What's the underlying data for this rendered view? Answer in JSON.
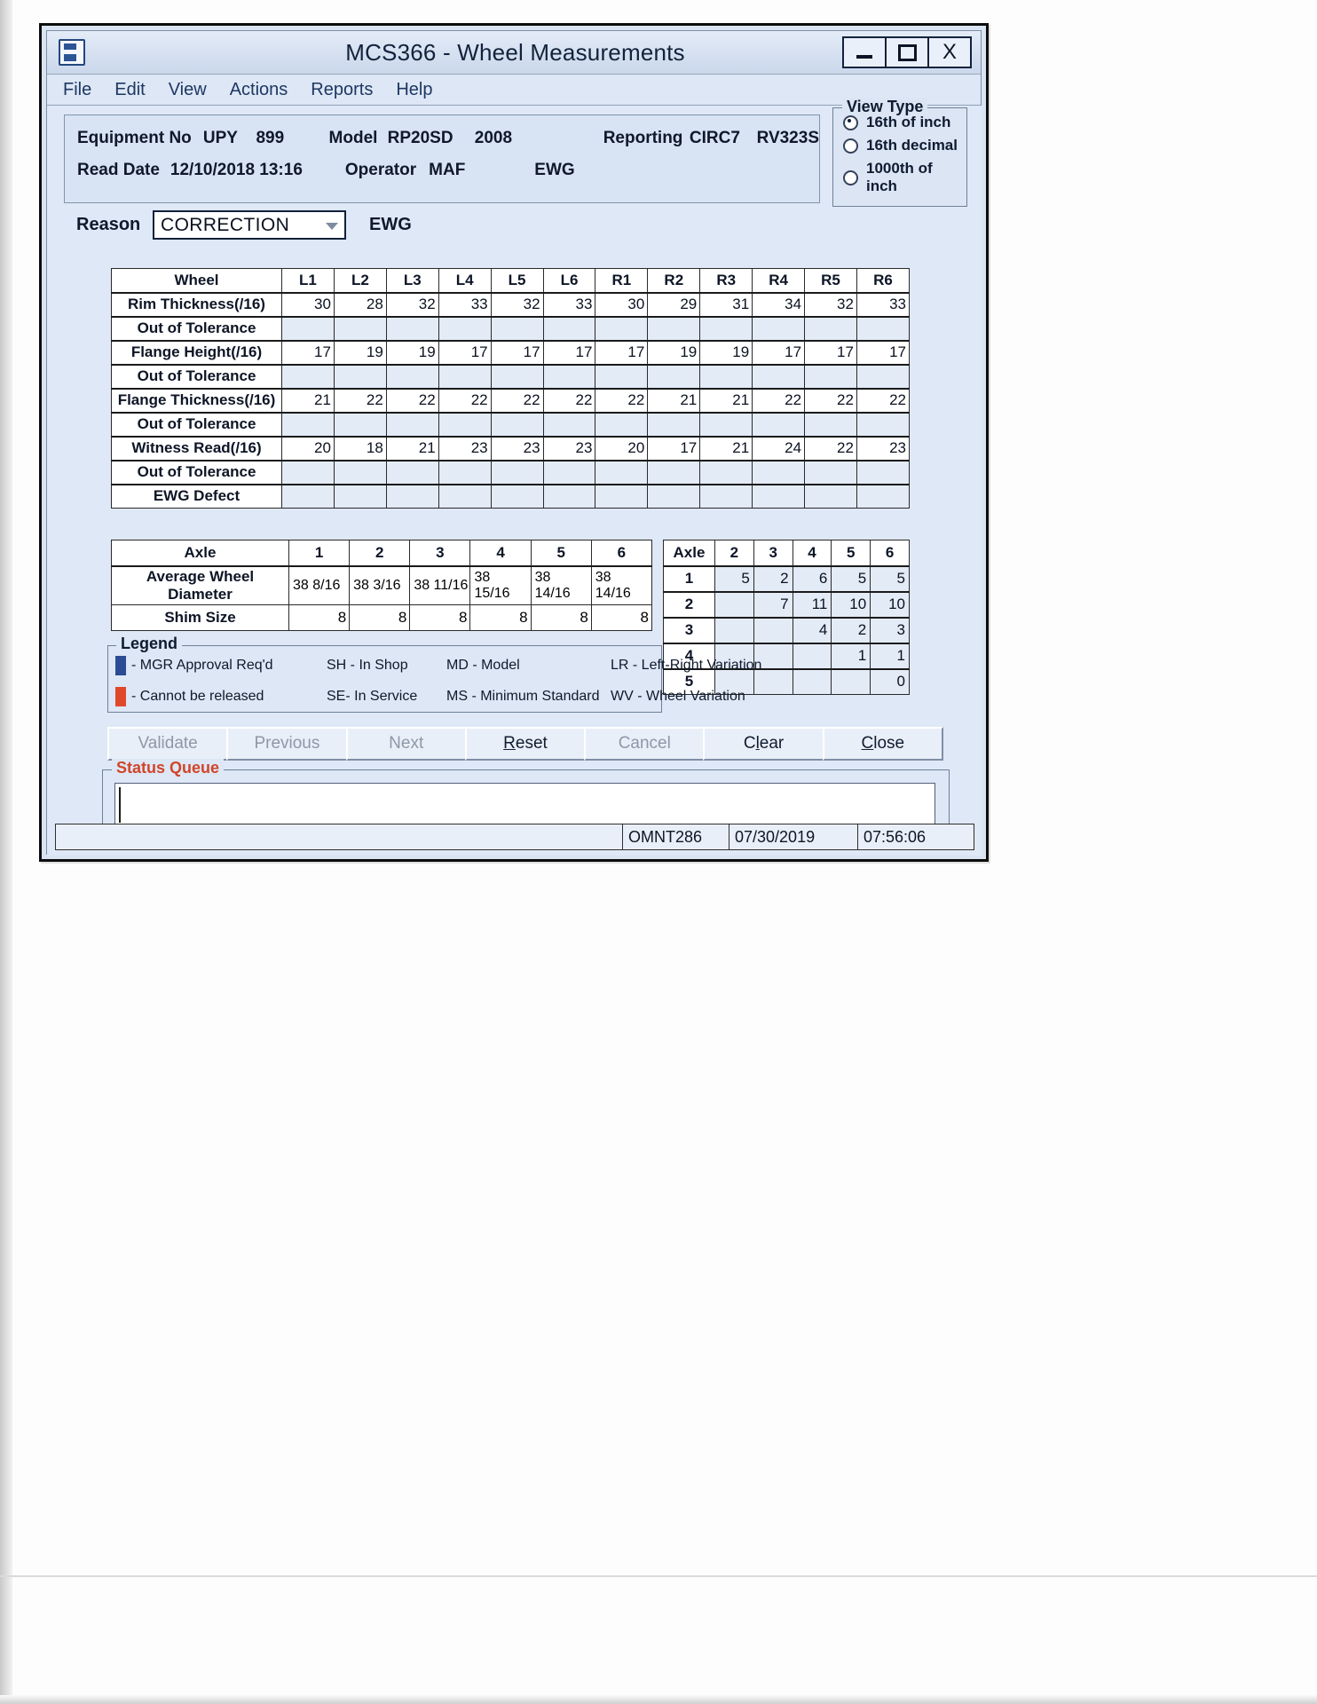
{
  "window": {
    "title": "MCS366 - Wheel Measurements",
    "icon": "save-disk-icon",
    "buttons": {
      "minimize": "minimize-icon",
      "maximize": "maximize-icon",
      "close": "X"
    }
  },
  "menubar": {
    "items": [
      "File",
      "Edit",
      "View",
      "Actions",
      "Reports",
      "Help"
    ]
  },
  "header": {
    "equipment_label": "Equipment No",
    "equipment_prefix": "UPY",
    "equipment_number": "899",
    "model_label": "Model",
    "model_value": "RP20SD",
    "model_year": "2008",
    "reporting_label": "Reporting",
    "reporting_value": "CIRC7",
    "reporting_code": "RV323S",
    "read_date_label": "Read Date",
    "read_date_value": "12/10/2018 13:16",
    "operator_label": "Operator",
    "operator_value": "MAF",
    "operator_group": "EWG"
  },
  "view_type": {
    "legend": "View Type",
    "options": [
      {
        "label": "16th of inch",
        "selected": true
      },
      {
        "label": "16th decimal",
        "selected": false
      },
      {
        "label": "1000th of inch",
        "selected": false
      }
    ]
  },
  "reason": {
    "label": "Reason",
    "value": "CORRECTION",
    "suffix": "EWG",
    "options": [
      "CORRECTION"
    ]
  },
  "wheel_table": {
    "corner_label": "Wheel",
    "columns": [
      "L1",
      "L2",
      "L3",
      "L4",
      "L5",
      "L6",
      "R1",
      "R2",
      "R3",
      "R4",
      "R5",
      "R6"
    ],
    "rows": [
      {
        "label": "Rim Thickness(/16)",
        "values": [
          "30",
          "28",
          "32",
          "33",
          "32",
          "33",
          "30",
          "29",
          "31",
          "34",
          "32",
          "33"
        ]
      },
      {
        "label": "Out of Tolerance",
        "values": [
          "",
          "",
          "",
          "",
          "",
          "",
          "",
          "",
          "",
          "",
          "",
          ""
        ]
      },
      {
        "label": "Flange Height(/16)",
        "values": [
          "17",
          "19",
          "19",
          "17",
          "17",
          "17",
          "17",
          "19",
          "19",
          "17",
          "17",
          "17"
        ]
      },
      {
        "label": "Out of Tolerance",
        "values": [
          "",
          "",
          "",
          "",
          "",
          "",
          "",
          "",
          "",
          "",
          "",
          ""
        ]
      },
      {
        "label": "Flange Thickness(/16)",
        "values": [
          "21",
          "22",
          "22",
          "22",
          "22",
          "22",
          "22",
          "21",
          "21",
          "22",
          "22",
          "22"
        ]
      },
      {
        "label": "Out of Tolerance",
        "values": [
          "",
          "",
          "",
          "",
          "",
          "",
          "",
          "",
          "",
          "",
          "",
          ""
        ]
      },
      {
        "label": "Witness Read(/16)",
        "values": [
          "20",
          "18",
          "21",
          "23",
          "23",
          "23",
          "20",
          "17",
          "21",
          "24",
          "22",
          "23"
        ]
      },
      {
        "label": "Out of Tolerance",
        "values": [
          "",
          "",
          "",
          "",
          "",
          "",
          "",
          "",
          "",
          "",
          "",
          ""
        ]
      },
      {
        "label": "EWG Defect",
        "values": [
          "",
          "",
          "",
          "",
          "",
          "",
          "",
          "",
          "",
          "",
          "",
          ""
        ]
      }
    ]
  },
  "axle_table": {
    "corner_label": "Axle",
    "columns": [
      "1",
      "2",
      "3",
      "4",
      "5",
      "6"
    ],
    "rows": [
      {
        "label": "Average Wheel Diameter",
        "values": [
          "38  8/16",
          "38  3/16",
          "38 11/16",
          "38 15/16",
          "38 14/16",
          "38 14/16"
        ]
      },
      {
        "label": "Shim Size",
        "values": [
          "8",
          "8",
          "8",
          "8",
          "8",
          "8"
        ]
      }
    ]
  },
  "variation_table": {
    "corner_label": "Axle",
    "columns": [
      "2",
      "3",
      "4",
      "5",
      "6"
    ],
    "rows": [
      {
        "label": "1",
        "values": [
          "5",
          "2",
          "6",
          "5",
          "5"
        ]
      },
      {
        "label": "2",
        "values": [
          "",
          "7",
          "11",
          "10",
          "10"
        ]
      },
      {
        "label": "3",
        "values": [
          "",
          "",
          "4",
          "2",
          "3"
        ]
      },
      {
        "label": "4",
        "values": [
          "",
          "",
          "",
          "1",
          "1"
        ]
      },
      {
        "label": "5",
        "values": [
          "",
          "",
          "",
          "",
          "0"
        ]
      }
    ]
  },
  "legend": {
    "title": "Legend",
    "blue_color": "#2b4b93",
    "red_color": "#e0482c",
    "rows": [
      {
        "swatch": "blue",
        "c1": "- MGR Approval Req'd",
        "c2": "SH - In Shop",
        "c3": "MD - Model",
        "c4": "LR - Left-Right Variation"
      },
      {
        "swatch": "red",
        "c1": "- Cannot be released",
        "c2": "SE- In Service",
        "c3": "MS - Minimum Standard",
        "c4": "WV - Wheel Variation"
      }
    ]
  },
  "buttons": [
    {
      "label": "Validate",
      "enabled": false,
      "accel": ""
    },
    {
      "label": "Previous",
      "enabled": false,
      "accel": ""
    },
    {
      "label": "Next",
      "enabled": false,
      "accel": ""
    },
    {
      "label": "Reset",
      "enabled": true,
      "accel": "R"
    },
    {
      "label": "Cancel",
      "enabled": false,
      "accel": ""
    },
    {
      "label": "Clear",
      "enabled": true,
      "accel": "l"
    },
    {
      "label": "Close",
      "enabled": true,
      "accel": "C"
    }
  ],
  "status_queue": {
    "title": "Status Queue",
    "value": "",
    "placeholder": ""
  },
  "statusbar": {
    "message": "",
    "terminal": "OMNT286",
    "date": "07/30/2019",
    "time": "07:56:06"
  }
}
